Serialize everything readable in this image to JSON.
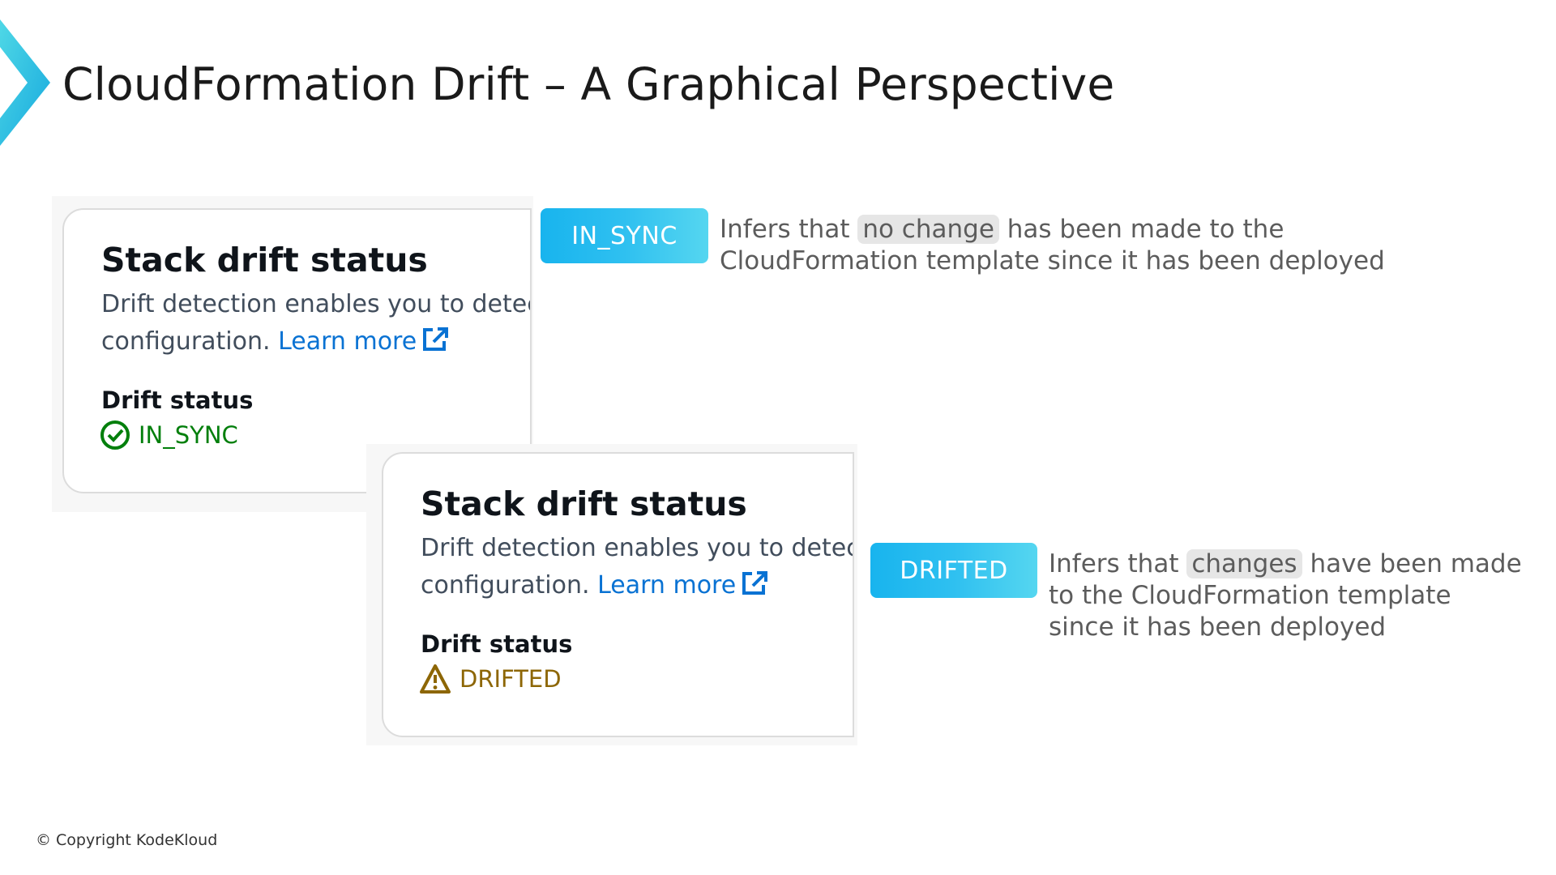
{
  "slide": {
    "title": "CloudFormation Drift – A Graphical Perspective",
    "accent_color": "#2dc6e8",
    "copyright": "© Copyright KodeKloud"
  },
  "cards": [
    {
      "title": "Stack drift status",
      "description_line1": "Drift detection enables you to detect",
      "description_line2_prefix": "configuration.",
      "learn_more": "Learn more",
      "drift_label": "Drift status",
      "status_icon": "check-circle-icon",
      "status_value": "IN_SYNC",
      "status_color": "#037f0c"
    },
    {
      "title": "Stack drift status",
      "description_line1": "Drift detection enables you to detect",
      "description_line2_prefix": "configuration.",
      "learn_more": "Learn more",
      "drift_label": "Drift status",
      "status_icon": "warning-triangle-icon",
      "status_value": "DRIFTED",
      "status_color": "#8d6605"
    }
  ],
  "badges": [
    {
      "label": "IN_SYNC",
      "note_prefix": "Infers that",
      "note_highlight": "no change",
      "note_suffix": "has been made to the",
      "note_line2": "CloudFormation template since it has been deployed"
    },
    {
      "label": "DRIFTED",
      "note_prefix": "Infers that",
      "note_highlight": "changes",
      "note_suffix": "have been made",
      "note_line2": "to the CloudFormation template",
      "note_line3": "since it has been deployed"
    }
  ]
}
